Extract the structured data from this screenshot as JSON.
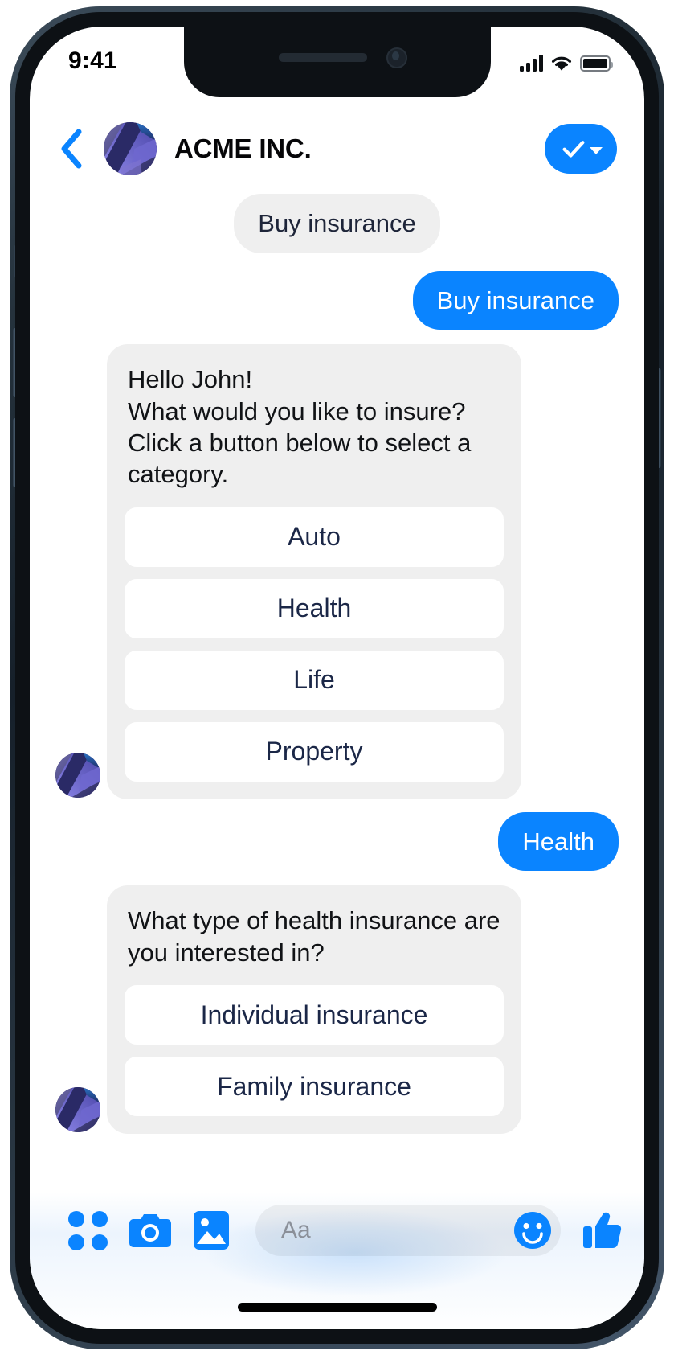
{
  "status_bar": {
    "time": "9:41",
    "signal_icon": "cellular-signal-icon",
    "wifi_icon": "wifi-icon",
    "battery_icon": "battery-full-icon"
  },
  "header": {
    "back_icon": "chevron-left-icon",
    "avatar": "company-avatar",
    "title": "ACME INC.",
    "action_icon": "checkmark-icon",
    "action_caret_icon": "caret-down-icon"
  },
  "conversation": {
    "messages": [
      {
        "type": "prompt-pill",
        "text": "Buy insurance"
      },
      {
        "type": "outgoing",
        "text": "Buy insurance"
      },
      {
        "type": "card",
        "text": "Hello John!\nWhat would you like to insure?\nClick a button below to select a category.",
        "options": [
          "Auto",
          "Health",
          "Life",
          "Property"
        ]
      },
      {
        "type": "outgoing",
        "text": "Health"
      },
      {
        "type": "card",
        "text": "What type of health insurance are you interested in?",
        "options": [
          "Individual insurance",
          "Family insurance"
        ]
      }
    ]
  },
  "input_bar": {
    "grid_icon": "apps-grid-icon",
    "camera_icon": "camera-icon",
    "gallery_icon": "image-gallery-icon",
    "placeholder": "Aa",
    "emoji_icon": "smiley-face-icon",
    "like_icon": "thumbs-up-icon"
  },
  "colors": {
    "accent_blue": "#0a84ff",
    "bubble_gray": "#efefef",
    "bubble_text_navy": "#1b2747",
    "white": "#ffffff"
  }
}
